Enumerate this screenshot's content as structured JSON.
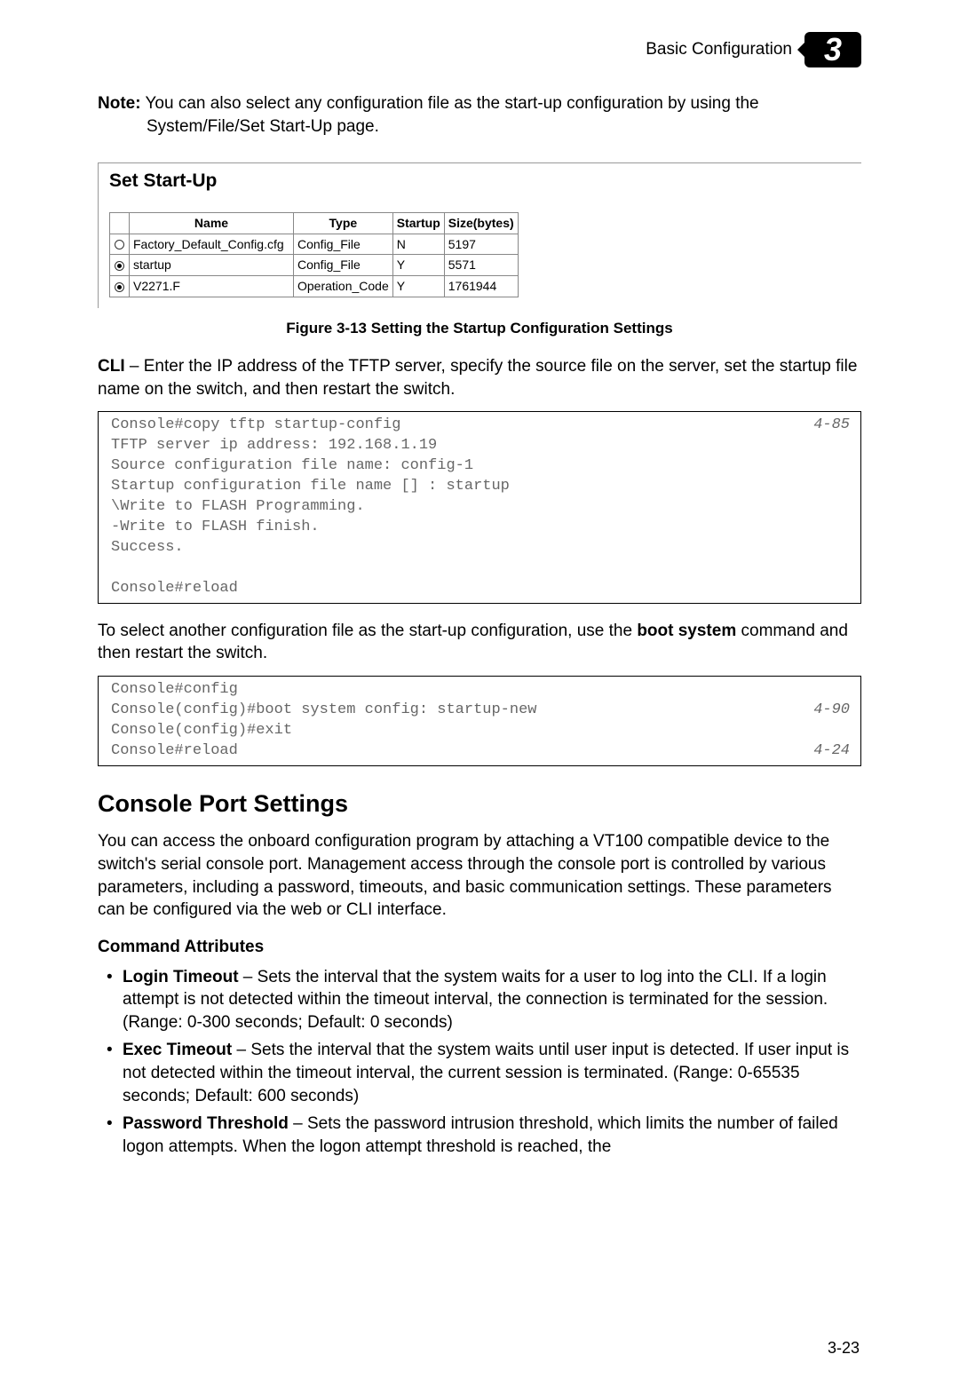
{
  "header": {
    "title": "Basic Configuration",
    "chapter": "3"
  },
  "note": {
    "label": "Note:",
    "line1": " You can also select any configuration file as the start-up configuration by using the",
    "line2": "System/File/Set Start-Up page."
  },
  "panel": {
    "title": "Set Start-Up",
    "headers": {
      "name": "Name",
      "type": "Type",
      "startup": "Startup",
      "size": "Size(bytes)"
    },
    "rows": [
      {
        "selected": false,
        "name": "Factory_Default_Config.cfg",
        "type": "Config_File",
        "startup": "N",
        "size": "5197"
      },
      {
        "selected": true,
        "name": "startup",
        "type": "Config_File",
        "startup": "Y",
        "size": "5571"
      },
      {
        "selected": true,
        "name": "V2271.F",
        "type": "Operation_Code",
        "startup": "Y",
        "size": "1761944"
      }
    ]
  },
  "figure": {
    "caption": "Figure 3-13  Setting the Startup Configuration Settings"
  },
  "cli_para": {
    "bold": "CLI",
    "rest": " – Enter the IP address of the TFTP server, specify the source file on the server, set the startup file name on the switch, and then restart the switch."
  },
  "code1": {
    "ref1": "4-85",
    "l1": "Console#copy tftp startup-config",
    "l2": "TFTP server ip address: 192.168.1.19",
    "l3": "Source configuration file name: config-1",
    "l4": "Startup configuration file name [] : startup",
    "l5": "\\Write to FLASH Programming.",
    "l6": "-Write to FLASH finish.",
    "l7": "Success.",
    "l8": "",
    "l9": "Console#reload"
  },
  "para2": {
    "t1": "To select another configuration file as the start-up configuration, use the ",
    "b1": "boot system",
    "t2": " command and then restart the switch."
  },
  "code2": {
    "l1": "Console#config",
    "l2a": "Console(config)#boot system config: startup-new",
    "ref2": "4-90",
    "l3": "Console(config)#exit",
    "l4a": "Console#reload",
    "ref3": "4-24"
  },
  "section": {
    "title": "Console Port Settings",
    "intro": "You can access the onboard configuration program by attaching a VT100 compatible device to the switch's serial console port. Management access through the console port is controlled by various parameters, including a password, timeouts, and basic communication settings. These parameters can be configured via the web or CLI interface.",
    "attrs_title": "Command Attributes",
    "items": [
      {
        "name": "Login Timeout",
        "desc": " – Sets the interval that the system waits for a user to log into the CLI. If a login attempt is not detected within the timeout interval, the connection is terminated for the session. (Range: 0-300 seconds; Default: 0 seconds)"
      },
      {
        "name": "Exec Timeout",
        "desc": " – Sets the interval that the system waits until user input is detected. If user input is not detected within the timeout interval, the current session is terminated. (Range: 0-65535 seconds; Default: 600 seconds)"
      },
      {
        "name": "Password Threshold",
        "desc": " – Sets the password intrusion threshold, which limits the number of failed logon attempts. When the logon attempt threshold is reached, the"
      }
    ]
  },
  "pagenum": "3-23"
}
